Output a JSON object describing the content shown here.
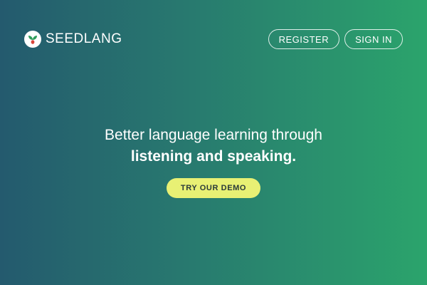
{
  "brand": {
    "name": "SEEDLANG",
    "logo_icon": "seedling-icon",
    "leaf_color": "#2e9c5a",
    "seed_color": "#d8453a"
  },
  "nav": {
    "register_label": "REGISTER",
    "signin_label": "SIGN IN"
  },
  "hero": {
    "headline_line1": "Better language learning through",
    "headline_line2": "listening and speaking.",
    "cta_label": "TRY OUR DEMO"
  },
  "colors": {
    "gradient_left": "#245a6e",
    "gradient_right": "#2ba46c",
    "cta_background": "#e8f074",
    "cta_text": "#2a3a3a"
  }
}
